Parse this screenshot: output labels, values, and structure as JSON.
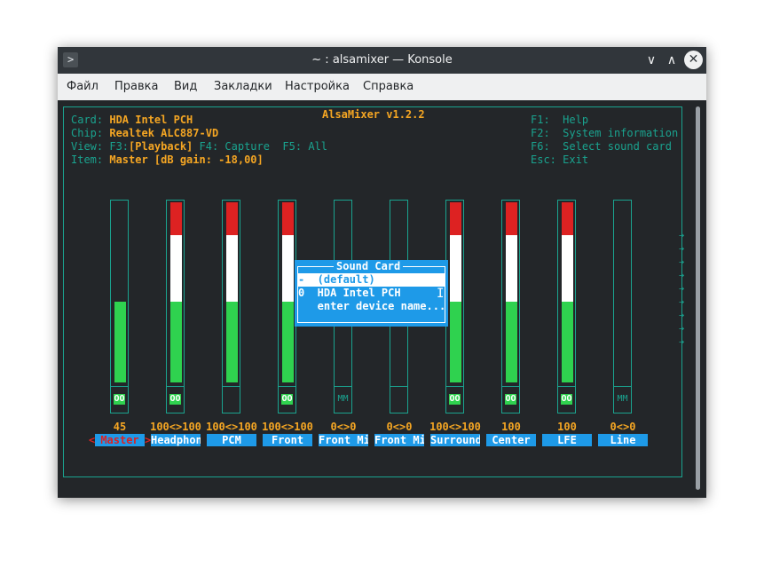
{
  "window": {
    "title": "~ : alsamixer — Konsole",
    "terminal_icon": "terminal-icon",
    "buttons": {
      "minimize": "∨",
      "maximize": "∧",
      "close": "✕"
    }
  },
  "menu": [
    "Файл",
    "Правка",
    "Вид",
    "Закладки",
    "Настройка",
    "Справка"
  ],
  "mixer": {
    "title": "AlsaMixer v1.2.2",
    "card_label": "Card: ",
    "card_value": "HDA Intel PCH",
    "chip_label": "Chip: ",
    "chip_value": "Realtek ALC887-VD",
    "view_label": "View: F3:",
    "view_playback": "[Playback]",
    "view_rest": " F4: Capture  F5: All",
    "item_label": "Item: ",
    "item_value": "Master [dB gain: -18,00]",
    "help": [
      {
        "key": "F1:",
        "text": "Help"
      },
      {
        "key": "F2:",
        "text": "System information"
      },
      {
        "key": "F6:",
        "text": "Select sound card"
      },
      {
        "key": "Esc:",
        "text": "Exit"
      }
    ],
    "channels": [
      {
        "name": "Master",
        "volume": "45",
        "level": 0.45,
        "mute": "OO",
        "selected": true
      },
      {
        "name": "Headphon",
        "volume": "100<>100",
        "level": 1.0,
        "mute": "OO"
      },
      {
        "name": "PCM",
        "volume": "100<>100",
        "level": 1.0,
        "mute": ""
      },
      {
        "name": "Front",
        "volume": "100<>100",
        "level": 1.0,
        "mute": "OO"
      },
      {
        "name": "Front Mi",
        "volume": "0<>0",
        "level": 0,
        "mute": "MM"
      },
      {
        "name": "Front Mi",
        "volume": "0<>0",
        "level": 0,
        "mute": ""
      },
      {
        "name": "Surround",
        "volume": "100<>100",
        "level": 1.0,
        "mute": "OO"
      },
      {
        "name": "Center",
        "volume": "100",
        "level": 1.0,
        "mute": "OO"
      },
      {
        "name": "LFE",
        "volume": "100",
        "level": 1.0,
        "mute": "OO"
      },
      {
        "name": "Line",
        "volume": "0<>0",
        "level": 0,
        "mute": "MM"
      }
    ],
    "select_arrows": {
      "left": "<",
      "right": ">"
    }
  },
  "popup": {
    "title": "Sound Card",
    "items": [
      {
        "text": "-  (default)",
        "selected": true
      },
      {
        "text": "0  HDA Intel PCH",
        "selected": false
      },
      {
        "text": "   enter device name...",
        "selected": false
      }
    ]
  },
  "colors": {
    "accent": "#1aa38f",
    "value": "#f5a623",
    "highlight": "#1e9ae8",
    "green": "#2fd24f",
    "red": "#dd2222"
  }
}
